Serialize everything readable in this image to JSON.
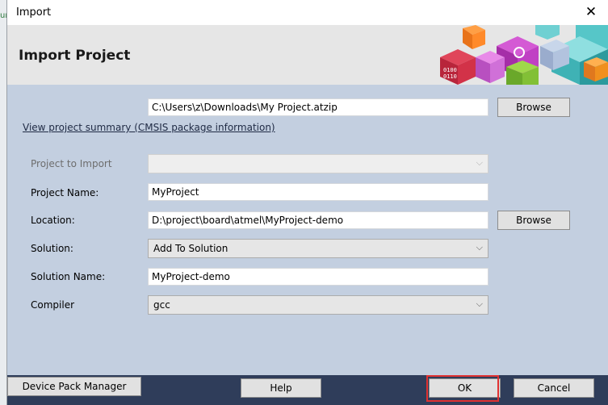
{
  "backdrop": {
    "fragment": "un"
  },
  "window": {
    "title": "Import",
    "close_glyph": "✕"
  },
  "banner": {
    "heading": "Import  Project",
    "icon": "colorful-blocks-logo"
  },
  "form": {
    "archive_path": "C:\\Users\\z\\Downloads\\My Project.atzip",
    "browse1": "Browse",
    "summary_link": "View project summary (CMSIS package information)",
    "project_to_import_label": "Project to Import",
    "project_to_import_value": "",
    "project_name_label": "Project Name:",
    "project_name_value": "MyProject",
    "location_label": "Location:",
    "location_value": "D:\\project\\board\\atmel\\MyProject-demo",
    "browse2": "Browse",
    "solution_label": "Solution:",
    "solution_value": "Add To Solution",
    "solution_name_label": "Solution Name:",
    "solution_name_value": "MyProject-demo",
    "compiler_label": "Compiler",
    "compiler_value": "gcc",
    "dropdown_arrow": "⌵"
  },
  "footer": {
    "device_pack_manager": "Device Pack Manager",
    "help": "Help",
    "ok": "OK",
    "cancel": "Cancel"
  },
  "colors": {
    "form_bg": "#c3cfe0",
    "footer_bg": "#2f3d5a",
    "highlight": "#e03131"
  }
}
